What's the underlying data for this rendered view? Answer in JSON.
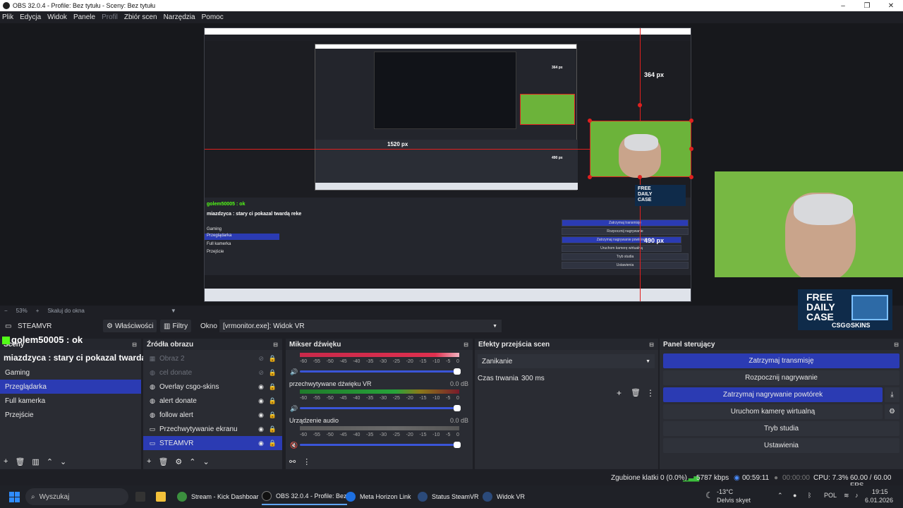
{
  "window": {
    "title": "OBS 32.0.4 - Profile: Bez tytułu - Sceny: Bez tytułu",
    "minimize": "–",
    "maximize": "❐",
    "close": "✕"
  },
  "menu": [
    "Plik",
    "Edycja",
    "Widok",
    "Panele",
    "Profil",
    "Zbiór scen",
    "Narzędzia",
    "Pomoc"
  ],
  "preview": {
    "px_364": "364 px",
    "px_1520": "1520 px",
    "px_490": "490 px",
    "inner_px_364": "364 px",
    "inner_px_490": "490 px",
    "nested_golem": "golem50005 : ok",
    "nested_miazd": "miazdzyca : stary ci pokazal twardą reke",
    "nested_buttons": [
      "Zatrzymaj transmisję",
      "Rozpocznij nagrywanie",
      "Zatrzymaj nagrywanie powtórek",
      "Uruchom kamerę wirtualną",
      "Tryb studia",
      "Ustawienia"
    ],
    "nested_scenes": [
      "Gaming",
      "Przeglądarka",
      "Full kamerka",
      "Przejście"
    ],
    "promo_free": "FREE DAILY CASE",
    "promo_brand": "CSG⊙SKINS",
    "nested_promo": "FREE DAILY CASE"
  },
  "zoom": {
    "value": "53%",
    "mode": "Skaluj do okna"
  },
  "source_bar": {
    "name": "STEAMVR",
    "properties": "Właściwości",
    "filters": "Filtry",
    "window_label": "Okno",
    "window_value": "[vrmonitor.exe]: Widok VR"
  },
  "chat_overlay": {
    "line1": "golem50005 : ok",
    "line2_user": "miazdzyca",
    "line2_text": " : stary ci pokazal twardą reke"
  },
  "scenes": {
    "title": "Sceny",
    "items": [
      "Gaming",
      "Przeglądarka",
      "Full kamerka",
      "Przejście"
    ],
    "selected_index": 1
  },
  "sources": {
    "title": "Źródła obrazu",
    "items": [
      {
        "name": "Obraz 2",
        "visible": false
      },
      {
        "name": "cel donate",
        "visible": false
      },
      {
        "name": "Overlay csgo-skins",
        "visible": true
      },
      {
        "name": "alert donate",
        "visible": true
      },
      {
        "name": "follow alert",
        "visible": true
      },
      {
        "name": "Przechwytywanie ekranu",
        "visible": true
      },
      {
        "name": "STEAMVR",
        "visible": true
      }
    ],
    "selected_index": 6
  },
  "mixer": {
    "title": "Mikser dźwięku",
    "scale": [
      "-60",
      "-55",
      "-50",
      "-45",
      "-40",
      "-35",
      "-30",
      "-25",
      "-20",
      "-15",
      "-10",
      "-5",
      "0"
    ],
    "channels": [
      {
        "name": "przechwytywane dźwięku VR",
        "db": "0.0 dB"
      },
      {
        "name": "Urządzenie audio",
        "db": "0.0 dB"
      }
    ]
  },
  "transitions": {
    "title": "Efekty przejścia scen",
    "selected": "Zanikanie",
    "duration_label": "Czas trwania",
    "duration_value": "300 ms"
  },
  "controls": {
    "title": "Panel sterujący",
    "stop_stream": "Zatrzymaj transmisję",
    "start_rec": "Rozpocznij nagrywanie",
    "stop_replay": "Zatrzymaj nagrywanie powtórek",
    "virtual_cam": "Uruchom kamerę wirtualną",
    "studio": "Tryb studia",
    "settings": "Ustawienia"
  },
  "status": {
    "dropped": "Zgubione klatki 0 (0.0%)",
    "bitrate": "5787 kbps",
    "stream_time": "00:59:11",
    "rec_time": "00:00:00",
    "cpu": "CPU: 7.3%",
    "fps": "60.00 / 60.00 FPS"
  },
  "taskbar": {
    "search": "Wyszukaj",
    "apps": [
      "Stream - Kick Dashboar",
      "OBS 32.0.4 - Profile: Bez",
      "Meta Horizon Link",
      "Status SteamVR",
      "Widok VR"
    ],
    "weather_temp": "-13°C",
    "weather_desc": "Delvis skyet",
    "lang": "POL",
    "time": "19:15",
    "date": "6.01.2026"
  },
  "colors": {
    "accent": "#2b3bb3",
    "kick_green": "#53fc18",
    "red": "#e0201f"
  }
}
